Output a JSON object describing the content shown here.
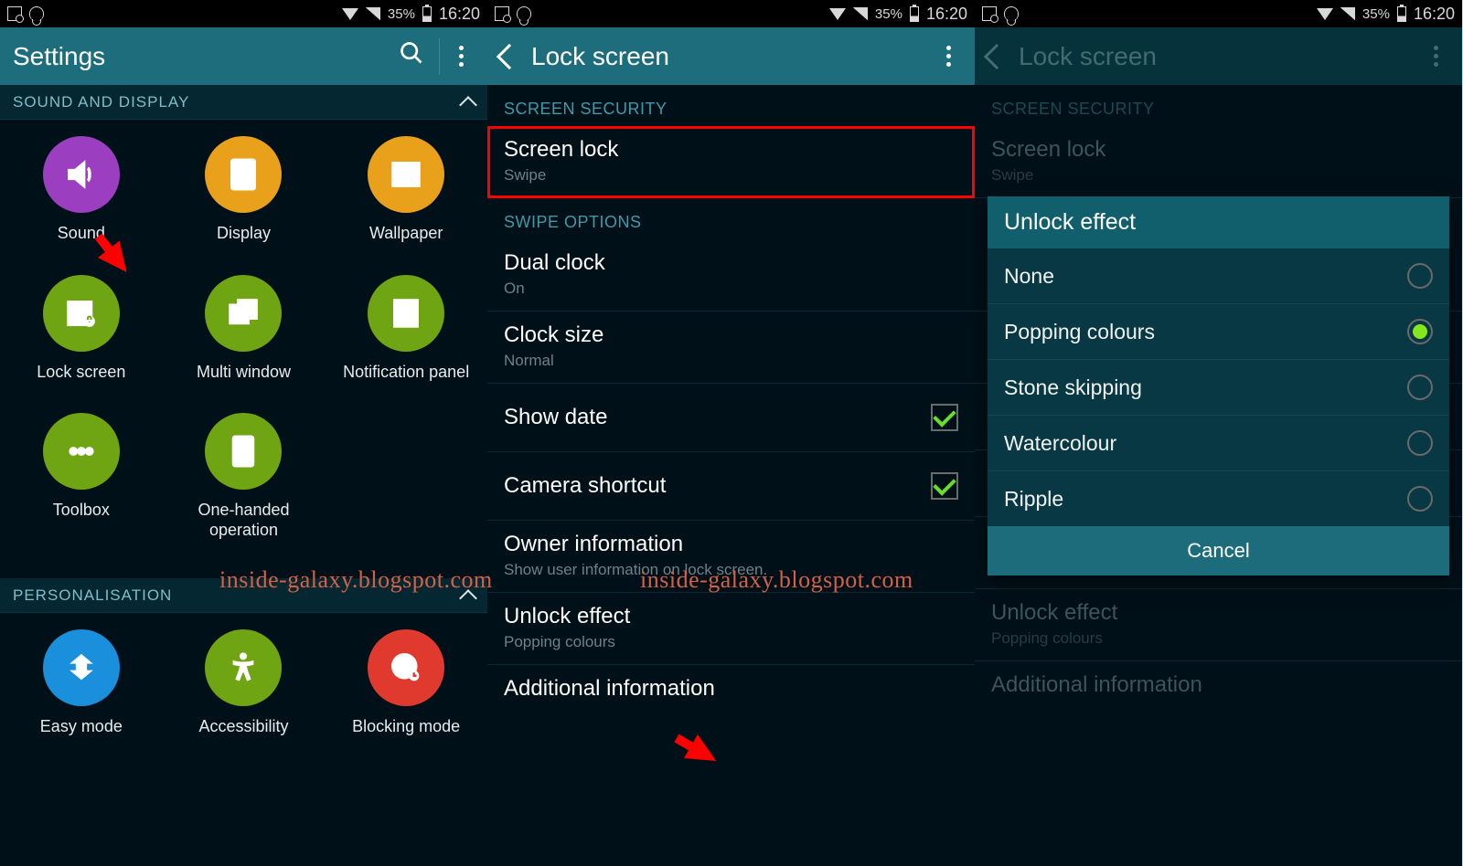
{
  "status": {
    "pct": "35%",
    "time": "16:20"
  },
  "panel1": {
    "title": "Settings",
    "sec1": "SOUND AND DISPLAY",
    "sec2": "PERSONALISATION",
    "i": {
      "sound": "Sound",
      "display": "Display",
      "wallpaper": "Wallpaper",
      "lock": "Lock screen",
      "multi": "Multi window",
      "notif": "Notification panel",
      "toolbox": "Toolbox",
      "onehand": "One-handed operation",
      "easy": "Easy mode",
      "access": "Accessibility",
      "block": "Blocking mode"
    }
  },
  "panel2": {
    "title": "Lock screen",
    "h1": "SCREEN SECURITY",
    "h2": "SWIPE OPTIONS",
    "r": {
      "screenlock": {
        "t": "Screen lock",
        "s": "Swipe"
      },
      "dual": {
        "t": "Dual clock",
        "s": "On"
      },
      "clocksize": {
        "t": "Clock size",
        "s": "Normal"
      },
      "showdate": {
        "t": "Show date"
      },
      "camsc": {
        "t": "Camera shortcut"
      },
      "owner": {
        "t": "Owner information",
        "s": "Show user information on lock screen."
      },
      "unlock": {
        "t": "Unlock effect",
        "s": "Popping colours"
      },
      "addl": {
        "t": "Additional information"
      }
    }
  },
  "panel3": {
    "title": "Lock screen",
    "dlg": {
      "title": "Unlock effect",
      "opts": {
        "none": "None",
        "pop": "Popping colours",
        "stone": "Stone skipping",
        "water": "Watercolour",
        "ripple": "Ripple"
      },
      "cancel": "Cancel"
    }
  },
  "wm": "inside-galaxy.blogspot.com"
}
